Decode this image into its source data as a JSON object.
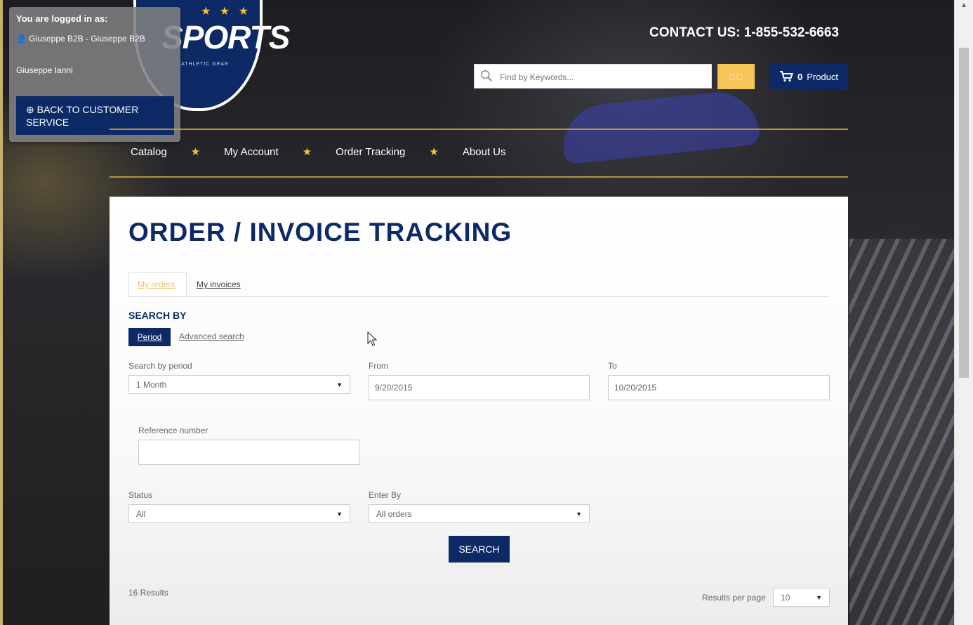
{
  "login_panel": {
    "title": "You are logged in as:",
    "user": "Giuseppe B2B - Giuseppe B2B",
    "name": "Giuseppe Ianni",
    "back_button": "BACK TO CUSTOMER SERVICE"
  },
  "logo": {
    "text": "SPORTS",
    "subtitle": "ATHLETIC GEAR"
  },
  "header": {
    "contact": "CONTACT US: 1-855-532-6663",
    "search_placeholder": "Find by Keywords...",
    "go_label": "GO",
    "cart_count": "0",
    "cart_label": "Product"
  },
  "nav": {
    "items": [
      {
        "label": "Catalog"
      },
      {
        "label": "My Account"
      },
      {
        "label": "Order Tracking"
      },
      {
        "label": "About Us"
      }
    ]
  },
  "page": {
    "title": "ORDER / INVOICE TRACKING",
    "tabs": [
      {
        "label": "My orders",
        "active": true
      },
      {
        "label": "My invoices",
        "active": false
      }
    ],
    "search_by": "SEARCH BY",
    "period_label": "Period",
    "advanced_label": "Advanced search",
    "fields": {
      "period": {
        "label": "Search by period",
        "value": "1 Month"
      },
      "from": {
        "label": "From",
        "value": "9/20/2015"
      },
      "to": {
        "label": "To",
        "value": "10/20/2015"
      },
      "reference": {
        "label": "Reference number",
        "value": ""
      },
      "status": {
        "label": "Status",
        "value": "All"
      },
      "enter_by": {
        "label": "Enter By",
        "value": "All orders"
      }
    },
    "search_button": "SEARCH",
    "results_text": "16 Results",
    "results_per_page_label": "Results per page",
    "results_per_page_value": "10"
  },
  "colors": {
    "brand_navy": "#0d2a66",
    "accent_gold": "#f6c233",
    "go_yellow": "#f6c55a"
  }
}
